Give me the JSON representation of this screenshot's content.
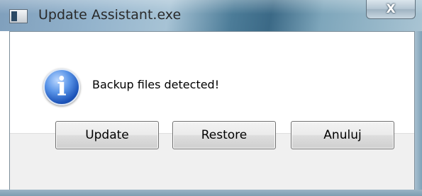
{
  "window": {
    "title": "Update Assistant.exe",
    "close_label": "X"
  },
  "message": {
    "icon": "info-icon",
    "text": "Backup files detected!"
  },
  "buttons": {
    "update_label": "Update",
    "restore_label": "Restore",
    "cancel_label": "Anuluj"
  },
  "colors": {
    "title_bar": "#3b6986",
    "info_icon": "#1c53b8",
    "footer": "#f0f0f0"
  }
}
